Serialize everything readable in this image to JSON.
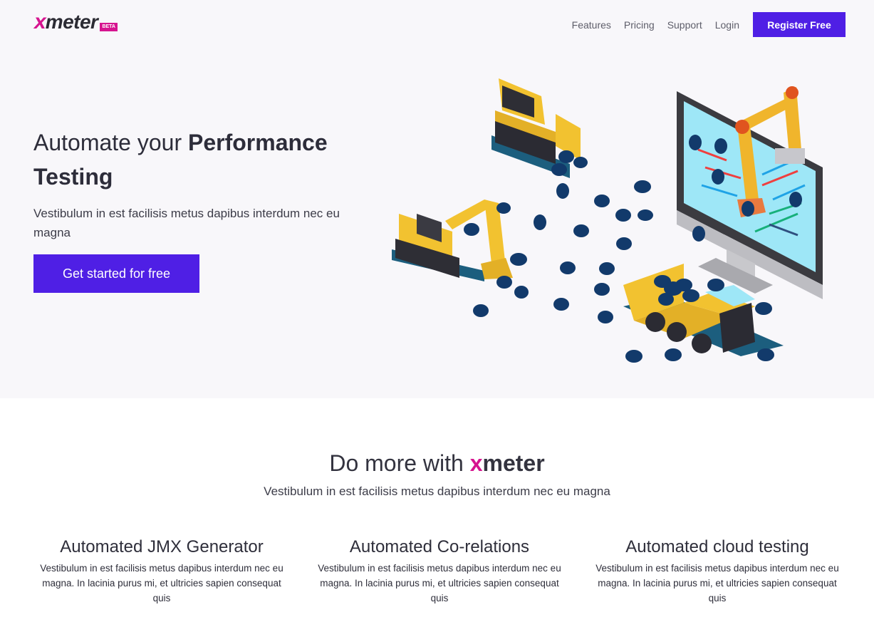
{
  "brand": {
    "x": "x",
    "meter": "meter",
    "badge": "BETA",
    "accent": "#d6148f",
    "primary": "#4f1fe5"
  },
  "nav": {
    "items": [
      "Features",
      "Pricing",
      "Support",
      "Login"
    ],
    "register_label": "Register Free"
  },
  "hero": {
    "title_light": "Automate your ",
    "title_bold": "Performance Testing",
    "subtitle": "Vestibulum in est facilisis metus dapibus interdum nec eu magna",
    "cta_label": "Get started for free",
    "illustration": "construction-vehicles-and-robot-arm-removing-bugs-from-monitor-illustration"
  },
  "section": {
    "title_prefix": "Do more with ",
    "title_x": "x",
    "title_meter": "meter",
    "subtitle": "Vestibulum in est facilisis metus dapibus interdum nec eu magna"
  },
  "features": [
    {
      "title": "Automated JMX Generator",
      "text": "Vestibulum in est facilisis metus dapibus interdum nec eu magna. In lacinia purus mi, et ultricies sapien consequat quis"
    },
    {
      "title": "Automated Co-relations",
      "text": "Vestibulum in est facilisis metus dapibus interdum nec eu magna. In lacinia purus mi, et ultricies sapien consequat quis"
    },
    {
      "title": "Automated cloud testing",
      "text": "Vestibulum in est facilisis metus dapibus interdum nec eu magna. In lacinia purus mi, et ultricies sapien consequat quis"
    }
  ]
}
